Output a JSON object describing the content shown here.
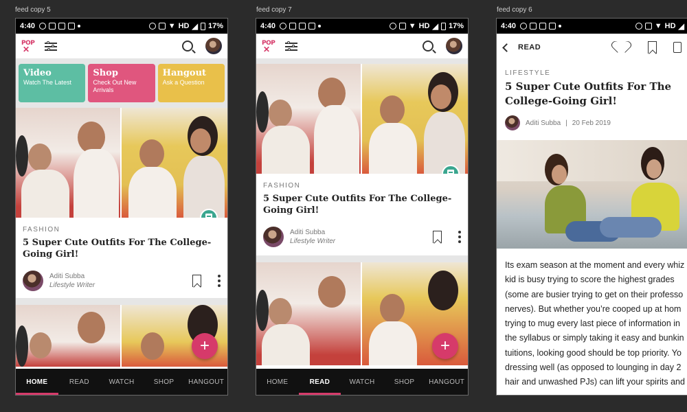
{
  "artboards": [
    {
      "label": "feed copy 5"
    },
    {
      "label": "feed copy 7"
    },
    {
      "label": "feed copy 6"
    }
  ],
  "statusbar": {
    "time": "4:40",
    "network": "HD",
    "battery": "17%"
  },
  "tiles": [
    {
      "title": "Video",
      "subtitle": "Watch The Latest",
      "color": "#5dbea3"
    },
    {
      "title": "Shop",
      "subtitle": "Check Out New Arrivals",
      "color": "#e0567e"
    },
    {
      "title": "Hangout",
      "subtitle": "Ask a Question",
      "color": "#e9c04a"
    }
  ],
  "article": {
    "category": "FASHION",
    "headline": "5 Super Cute Outfits For The College-Going Girl!",
    "author_name": "Aditi Subba",
    "author_role": "Lifestyle Writer"
  },
  "nav": [
    "HOME",
    "READ",
    "WATCH",
    "SHOP",
    "HANGOUT"
  ],
  "fab_symbol": "+",
  "reader": {
    "back_label": "READ",
    "category": "LIFESTYLE",
    "headline_line1": "5 Super Cute Outfits For The",
    "headline_line2": "College-Going Girl!",
    "author_name": "Aditi Subba",
    "separator": "|",
    "date": "20 Feb 2019",
    "body_lines": [
      "Its exam season at the moment and every whiz",
      "kid is busy trying to score the highest grades",
      "(some are busier trying to get on their professo",
      "nerves). But whether you’re cooped up at hom",
      "trying to mug every last piece of information in",
      "the syllabus or simply taking it easy and bunkin",
      "tuitions, looking good should be top priority. Yo",
      "dressing well (as opposed to lounging in day 2",
      "hair and unwashed PJs) can lift your spirits and"
    ]
  },
  "colors": {
    "accent": "#d63a6a",
    "badge": "#3aa68f",
    "navbar": "#111111"
  }
}
